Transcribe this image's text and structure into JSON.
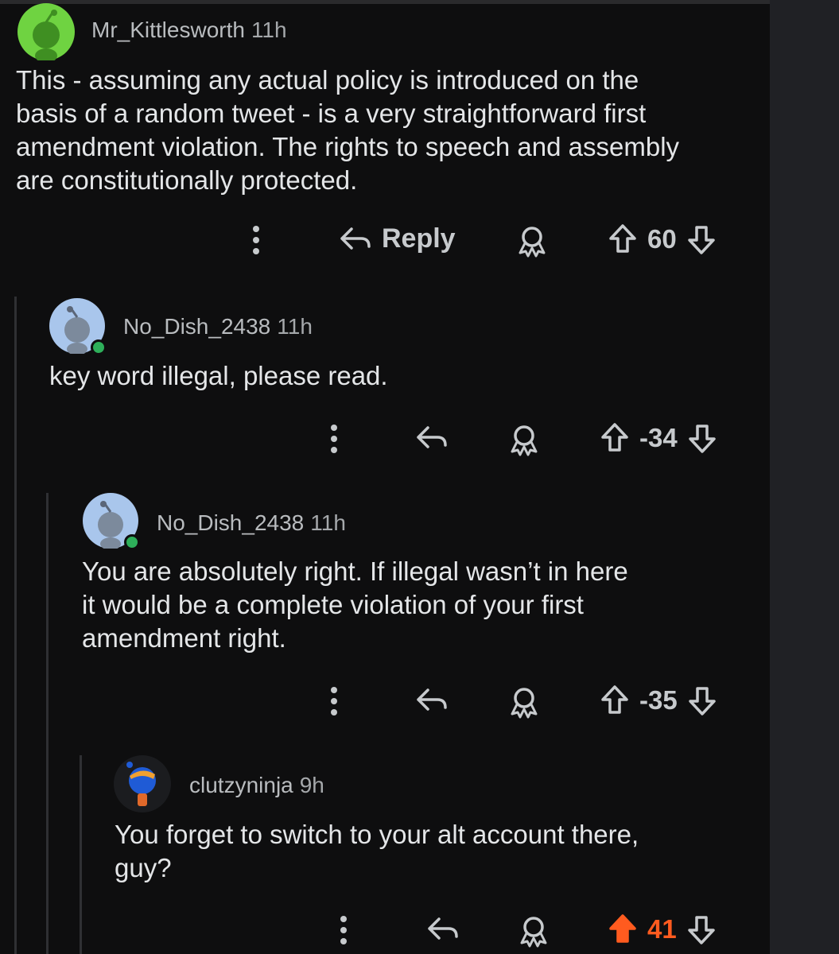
{
  "comments": [
    {
      "author": "Mr_Kittlesworth",
      "time": "11h",
      "body_lines": [
        "This - assuming any actual policy is introduced on the",
        "basis of a random tweet - is a very straightforward first",
        "amendment violation. The rights to speech and assembly",
        "are constitutionally protected."
      ],
      "reply_label": "Reply",
      "score": "60",
      "avatar_color": "#6fd341"
    },
    {
      "author": "No_Dish_2438",
      "time": "11h",
      "body_lines": [
        "key word illegal, please read."
      ],
      "score": "-34",
      "avatar_color": "#a9c6ec"
    },
    {
      "author": "No_Dish_2438",
      "time": "11h",
      "body_lines": [
        "You are absolutely right. If illegal wasn’t in here",
        "it would be a complete violation of your first",
        "amendment right."
      ],
      "score": "-35",
      "avatar_color": "#a9c6ec"
    },
    {
      "author": "clutzyninja",
      "time": "9h",
      "body_lines": [
        "You forget to switch to your alt account there,",
        "guy?"
      ],
      "score": "41",
      "upvoted": true,
      "avatar_color": "#1f5bd6"
    }
  ],
  "colors": {
    "background": "#0e0e0f",
    "text": "#e4e6e8",
    "meta": "#b9bcbf",
    "upvote_active": "#ff5b1f",
    "online": "#2eaf5a"
  },
  "icons": [
    "more-vertical-icon",
    "reply-arrow-icon",
    "award-icon",
    "upvote-arrow-icon",
    "downvote-arrow-icon"
  ]
}
